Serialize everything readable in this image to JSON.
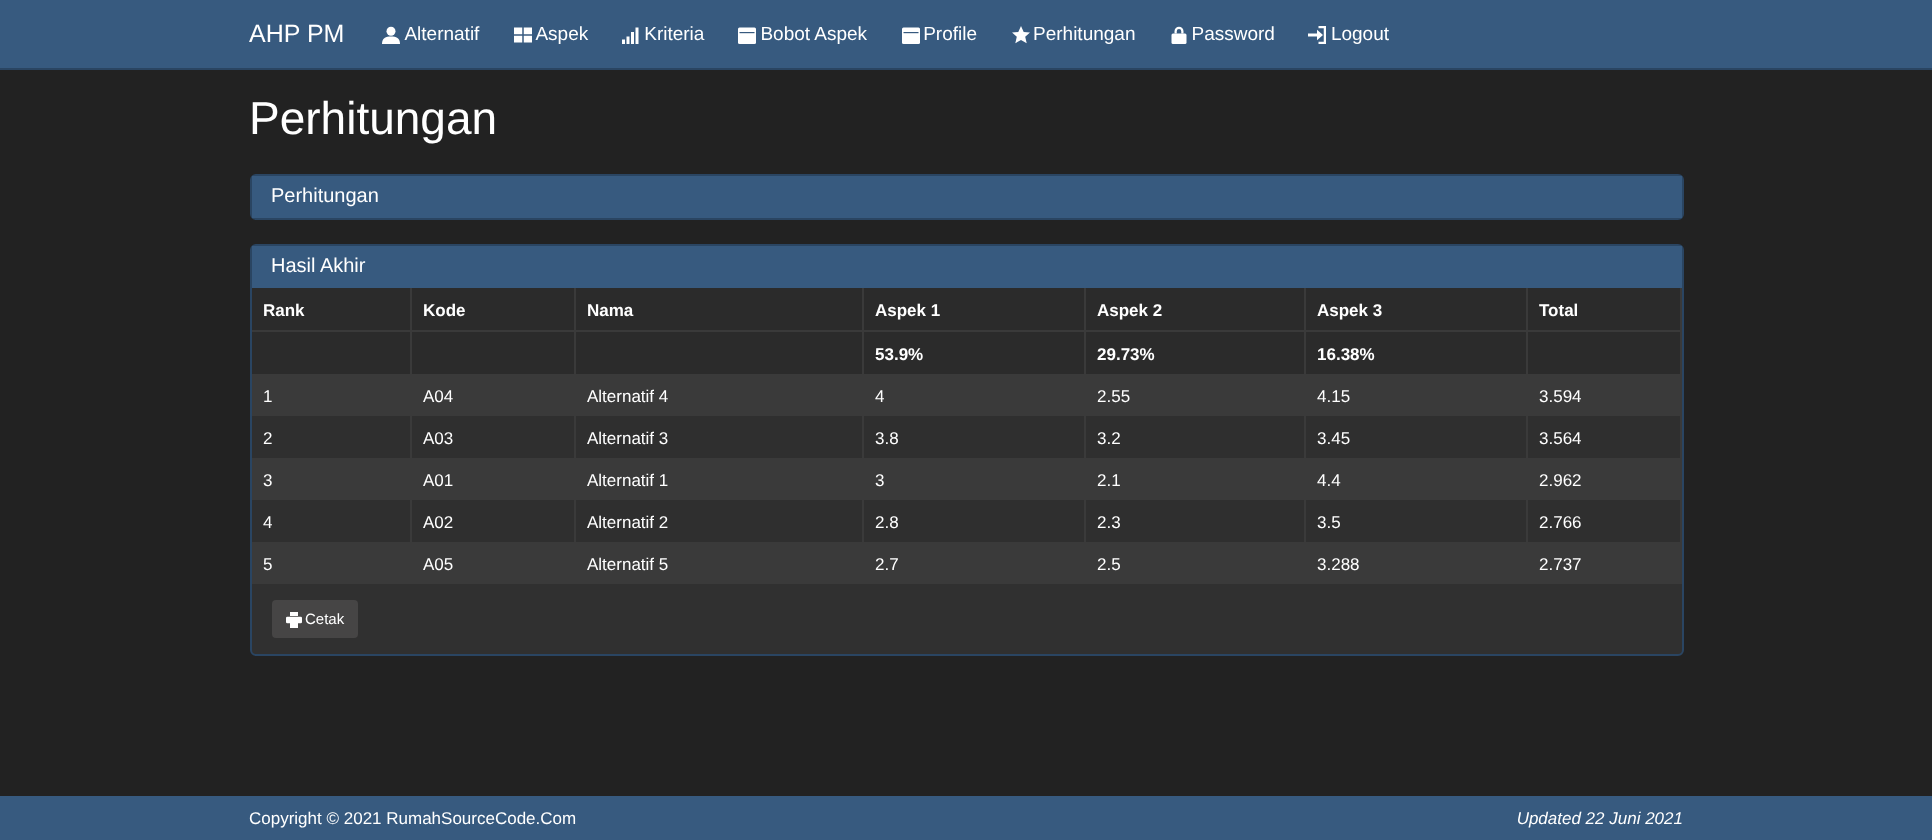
{
  "navbar": {
    "brand": "AHP PM",
    "items": [
      {
        "label": "Alternatif"
      },
      {
        "label": "Aspek"
      },
      {
        "label": "Kriteria"
      },
      {
        "label": "Bobot Aspek"
      },
      {
        "label": "Profile"
      },
      {
        "label": "Perhitungan"
      },
      {
        "label": "Password"
      },
      {
        "label": "Logout"
      }
    ]
  },
  "page_title": "Perhitungan",
  "breadcrumb_panel": {
    "title": "Perhitungan"
  },
  "result_panel": {
    "title": "Hasil Akhir",
    "table": {
      "columns": [
        "Rank",
        "Kode",
        "Nama",
        "Aspek 1",
        "Aspek 2",
        "Aspek 3",
        "Total"
      ],
      "rows": [
        [
          "",
          "",
          "",
          "53.9%",
          "29.73%",
          "16.38%",
          ""
        ],
        [
          "1",
          "A04",
          "Alternatif 4",
          "4",
          "2.55",
          "4.15",
          "3.594"
        ],
        [
          "2",
          "A03",
          "Alternatif 3",
          "3.8",
          "3.2",
          "3.45",
          "3.564"
        ],
        [
          "3",
          "A01",
          "Alternatif 1",
          "3",
          "2.1",
          "4.4",
          "2.962"
        ],
        [
          "4",
          "A02",
          "Alternatif 2",
          "2.8",
          "2.3",
          "3.5",
          "2.766"
        ],
        [
          "5",
          "A05",
          "Alternatif 5",
          "2.7",
          "2.5",
          "3.288",
          "2.737"
        ]
      ]
    },
    "print_button": "Cetak"
  },
  "footer": {
    "copyright": "Copyright © 2021 RumahSourceCode.Com",
    "updated": "Updated 22 Juni 2021"
  }
}
